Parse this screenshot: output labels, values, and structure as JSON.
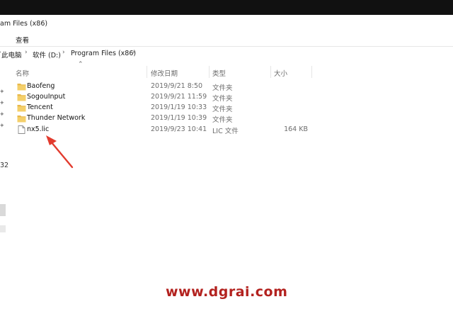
{
  "window": {
    "title": "am Files (x86)"
  },
  "menu": {
    "view_label": "查看"
  },
  "address": {
    "segments": [
      "此电脑",
      "软件 (D:)",
      "Program Files (x86)"
    ]
  },
  "columns": {
    "name": "名称",
    "date": "修改日期",
    "type": "类型",
    "size": "大小"
  },
  "nav_fragment": "32",
  "files": [
    {
      "name": "Baofeng",
      "date": "2019/9/21 8:50",
      "type": "文件夹",
      "size": "",
      "icon": "folder-icon"
    },
    {
      "name": "SogouInput",
      "date": "2019/9/21 11:59",
      "type": "文件夹",
      "size": "",
      "icon": "folder-icon"
    },
    {
      "name": "Tencent",
      "date": "2019/1/19 10:33",
      "type": "文件夹",
      "size": "",
      "icon": "folder-icon"
    },
    {
      "name": "Thunder Network",
      "date": "2019/1/19 10:39",
      "type": "文件夹",
      "size": "",
      "icon": "folder-icon"
    },
    {
      "name": "nx5.lic",
      "date": "2019/9/23 10:41",
      "type": "LIC 文件",
      "size": "164 KB",
      "icon": "file-icon"
    }
  ],
  "watermark": "www.dgrai.com",
  "colors": {
    "folder": "#e8b94a",
    "arrow": "#e23b2e",
    "watermark": "#b3221f"
  }
}
